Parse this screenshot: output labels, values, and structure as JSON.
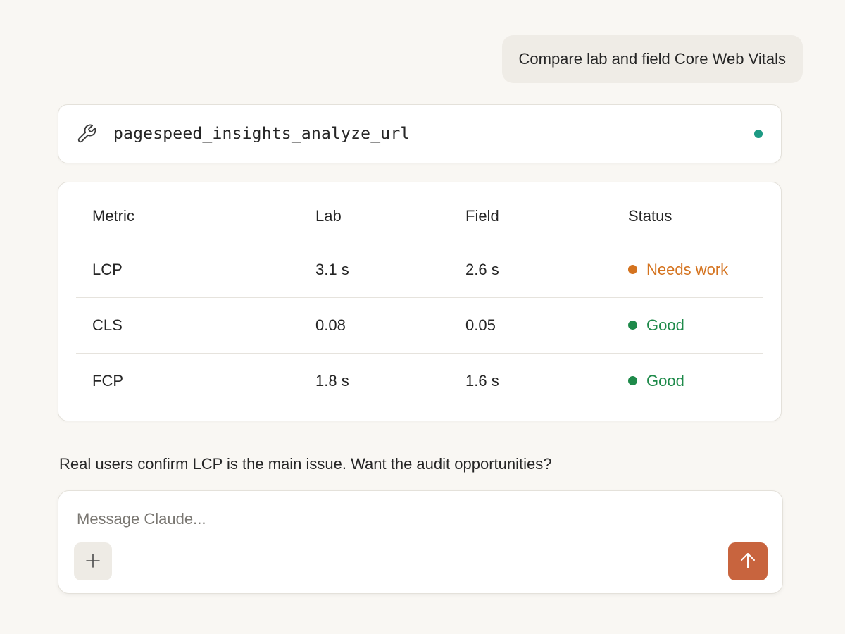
{
  "user_message": "Compare lab and field Core Web Vitals",
  "tool_call": {
    "name": "pagespeed_insights_analyze_url",
    "icon": "wrench-icon",
    "status_color": "#1d9a84"
  },
  "results_table": {
    "headers": [
      "Metric",
      "Lab",
      "Field",
      "Status"
    ],
    "rows": [
      {
        "metric": "LCP",
        "lab": "3.1 s",
        "field": "2.6 s",
        "status": "Needs work",
        "status_color": "#d4731f"
      },
      {
        "metric": "CLS",
        "lab": "0.08",
        "field": "0.05",
        "status": "Good",
        "status_color": "#1e8a4a"
      },
      {
        "metric": "FCP",
        "lab": "1.8 s",
        "field": "1.6 s",
        "status": "Good",
        "status_color": "#1e8a4a"
      }
    ]
  },
  "assistant_message": "Real users confirm LCP is the main issue. Want the audit opportunities?",
  "composer": {
    "placeholder": "Message Claude...",
    "value": "",
    "add_icon": "plus-icon",
    "send_icon": "arrow-up-icon",
    "send_color": "#c8643e"
  }
}
